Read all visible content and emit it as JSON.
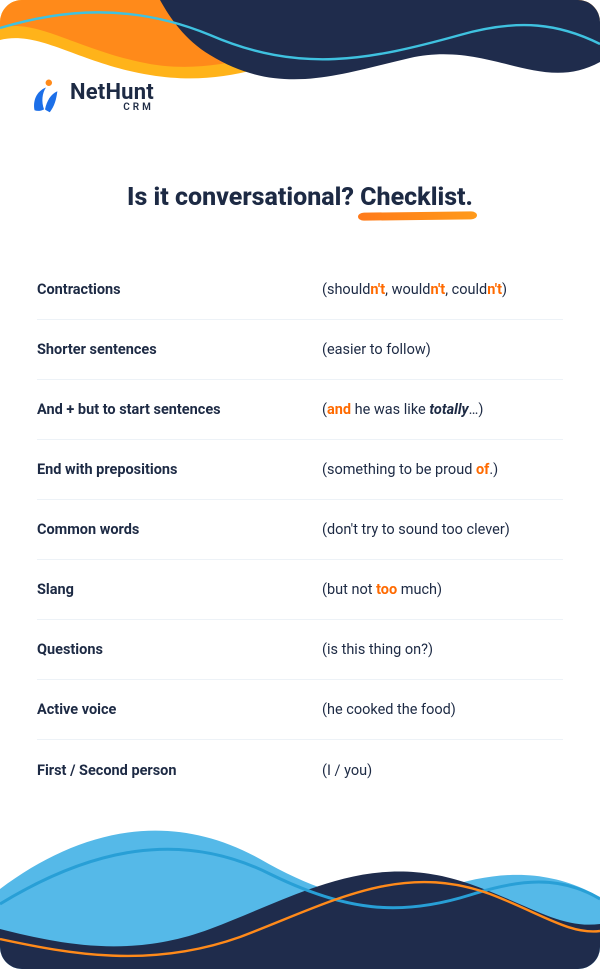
{
  "brand": {
    "name": "NetHunt",
    "subline": "CRM"
  },
  "heading": {
    "prefix": "Is it conversational? ",
    "underlined": "Checklist."
  },
  "colors": {
    "navy": "#1f2c4c",
    "orange": "#ff8a1a",
    "yellow": "#ffb31a",
    "cyan": "#3fc2e0",
    "lightblue": "#55b9e8",
    "accent": "#ff6a00"
  },
  "rows": [
    {
      "label": "Contractions",
      "example_parts": [
        {
          "t": "(should"
        },
        {
          "t": "n't",
          "hl": true
        },
        {
          "t": ", would"
        },
        {
          "t": "n't",
          "hl": true
        },
        {
          "t": ", could"
        },
        {
          "t": "n't",
          "hl": true
        },
        {
          "t": ")"
        }
      ]
    },
    {
      "label": "Shorter sentences",
      "example_parts": [
        {
          "t": "(easier to follow)"
        }
      ]
    },
    {
      "label": "And + but to start sentences",
      "example_parts": [
        {
          "t": "("
        },
        {
          "t": "and",
          "hl": true
        },
        {
          "t": " he was like "
        },
        {
          "t": "totally",
          "ital": true
        },
        {
          "t": "…)"
        }
      ]
    },
    {
      "label": "End with prepositions",
      "example_parts": [
        {
          "t": "(something to be proud "
        },
        {
          "t": "of",
          "hl": true
        },
        {
          "t": ".)"
        }
      ]
    },
    {
      "label": "Common words",
      "example_parts": [
        {
          "t": "(don't try to sound too clever)"
        }
      ]
    },
    {
      "label": "Slang",
      "example_parts": [
        {
          "t": "(but not "
        },
        {
          "t": "too",
          "hl": true
        },
        {
          "t": " much)"
        }
      ]
    },
    {
      "label": "Questions",
      "example_parts": [
        {
          "t": "(is this thing on?)"
        }
      ]
    },
    {
      "label": "Active voice",
      "example_parts": [
        {
          "t": "(he cooked the food)"
        }
      ]
    },
    {
      "label": "First / Second person",
      "example_parts": [
        {
          "t": "(I / you)"
        }
      ]
    }
  ]
}
